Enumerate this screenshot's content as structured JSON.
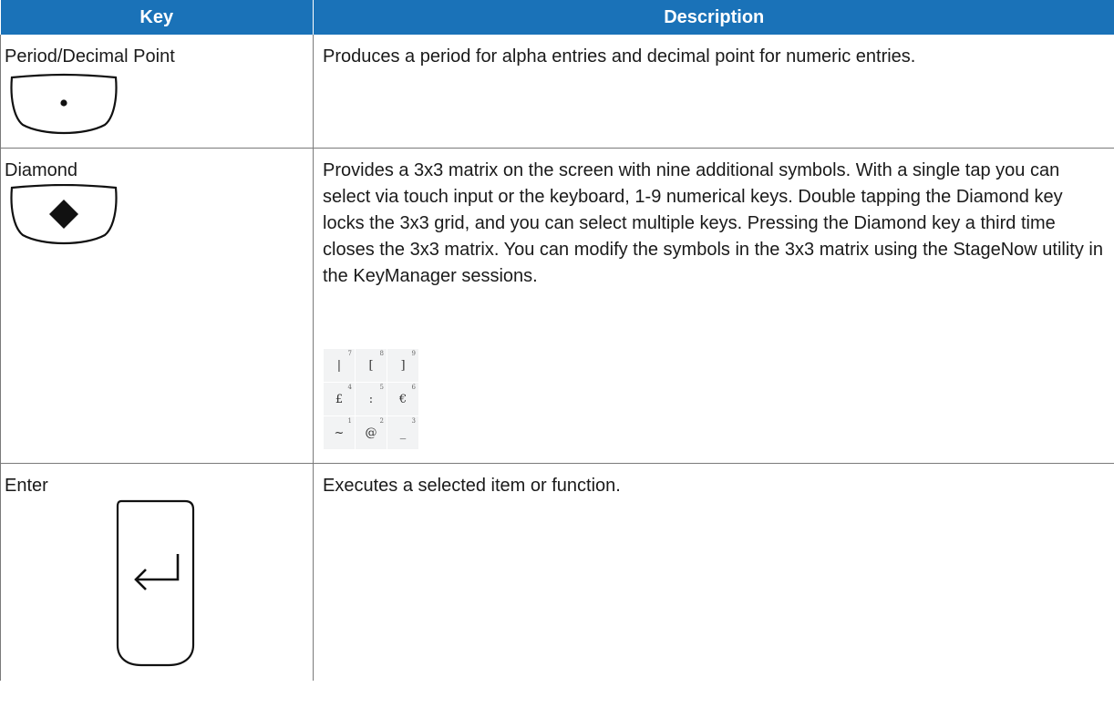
{
  "header": {
    "key": "Key",
    "description": "Description"
  },
  "rows": [
    {
      "key": "Period/Decimal Point",
      "icon": "period-key-icon",
      "description": "Produces a period for alpha entries and decimal point for numeric entries."
    },
    {
      "key": "Diamond",
      "icon": "diamond-key-icon",
      "description": "Provides a 3x3 matrix on the screen with nine additional symbols. With a single tap you can select via touch input or the keyboard, 1-9 numerical keys. Double tapping the Diamond key locks the 3x3 grid, and you can select multiple keys. Pressing the Diamond key a third time closes the 3x3 matrix. You can modify the symbols in the 3x3 matrix using the StageNow utility in the KeyManager sessions."
    },
    {
      "key": "Enter",
      "icon": "enter-key-icon",
      "description": "Executes a selected item or function."
    }
  ],
  "matrix": [
    [
      {
        "symbol": "|",
        "num": "7"
      },
      {
        "symbol": "[",
        "num": "8"
      },
      {
        "symbol": "]",
        "num": "9"
      }
    ],
    [
      {
        "symbol": "£",
        "num": "4"
      },
      {
        "symbol": ":",
        "num": "5"
      },
      {
        "symbol": "€",
        "num": "6"
      }
    ],
    [
      {
        "symbol": "~",
        "num": "1"
      },
      {
        "symbol": "@",
        "num": "2"
      },
      {
        "symbol": "_",
        "num": "3"
      }
    ]
  ],
  "colors": {
    "header_bg": "#1a72b8",
    "header_text": "#ffffff",
    "rule": "#7a7a7a"
  }
}
